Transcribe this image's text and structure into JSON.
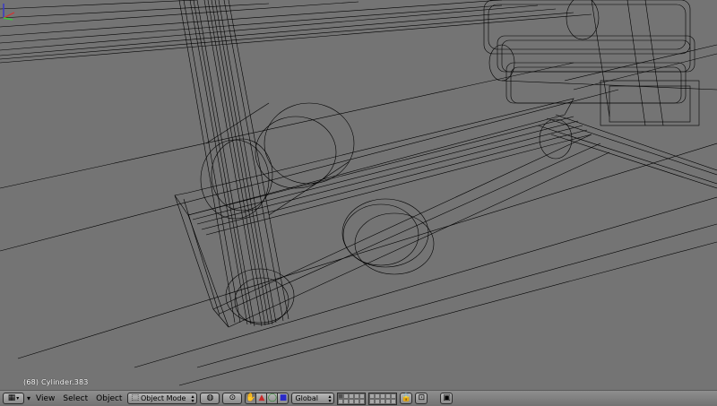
{
  "viewport": {
    "object_info": "(68) Cylinder.383",
    "background": "#747474",
    "wire_color": "#000000"
  },
  "header": {
    "editor_type_icon": "view3d-grid-icon",
    "menus": {
      "view": "View",
      "select": "Select",
      "object": "Object"
    },
    "mode": {
      "label": "Object Mode",
      "icon": "object-mode-icon"
    },
    "viewport_shading_icon": "sphere-shading-icon",
    "pivot_icon": "pivot-point-icon",
    "manipulator_icons": [
      "hand-icon",
      "translate-arrow-icon",
      "rotate-icon",
      "scale-icon"
    ],
    "orientation": "Global",
    "layers_first": [
      true,
      false,
      false,
      false,
      false,
      false,
      false,
      false,
      false,
      false
    ],
    "layers_second": [
      false,
      false,
      false,
      false,
      false,
      false,
      false,
      false,
      false,
      false
    ],
    "lock_icon": "lock-icon",
    "render_icon": "camera-render-icon"
  }
}
